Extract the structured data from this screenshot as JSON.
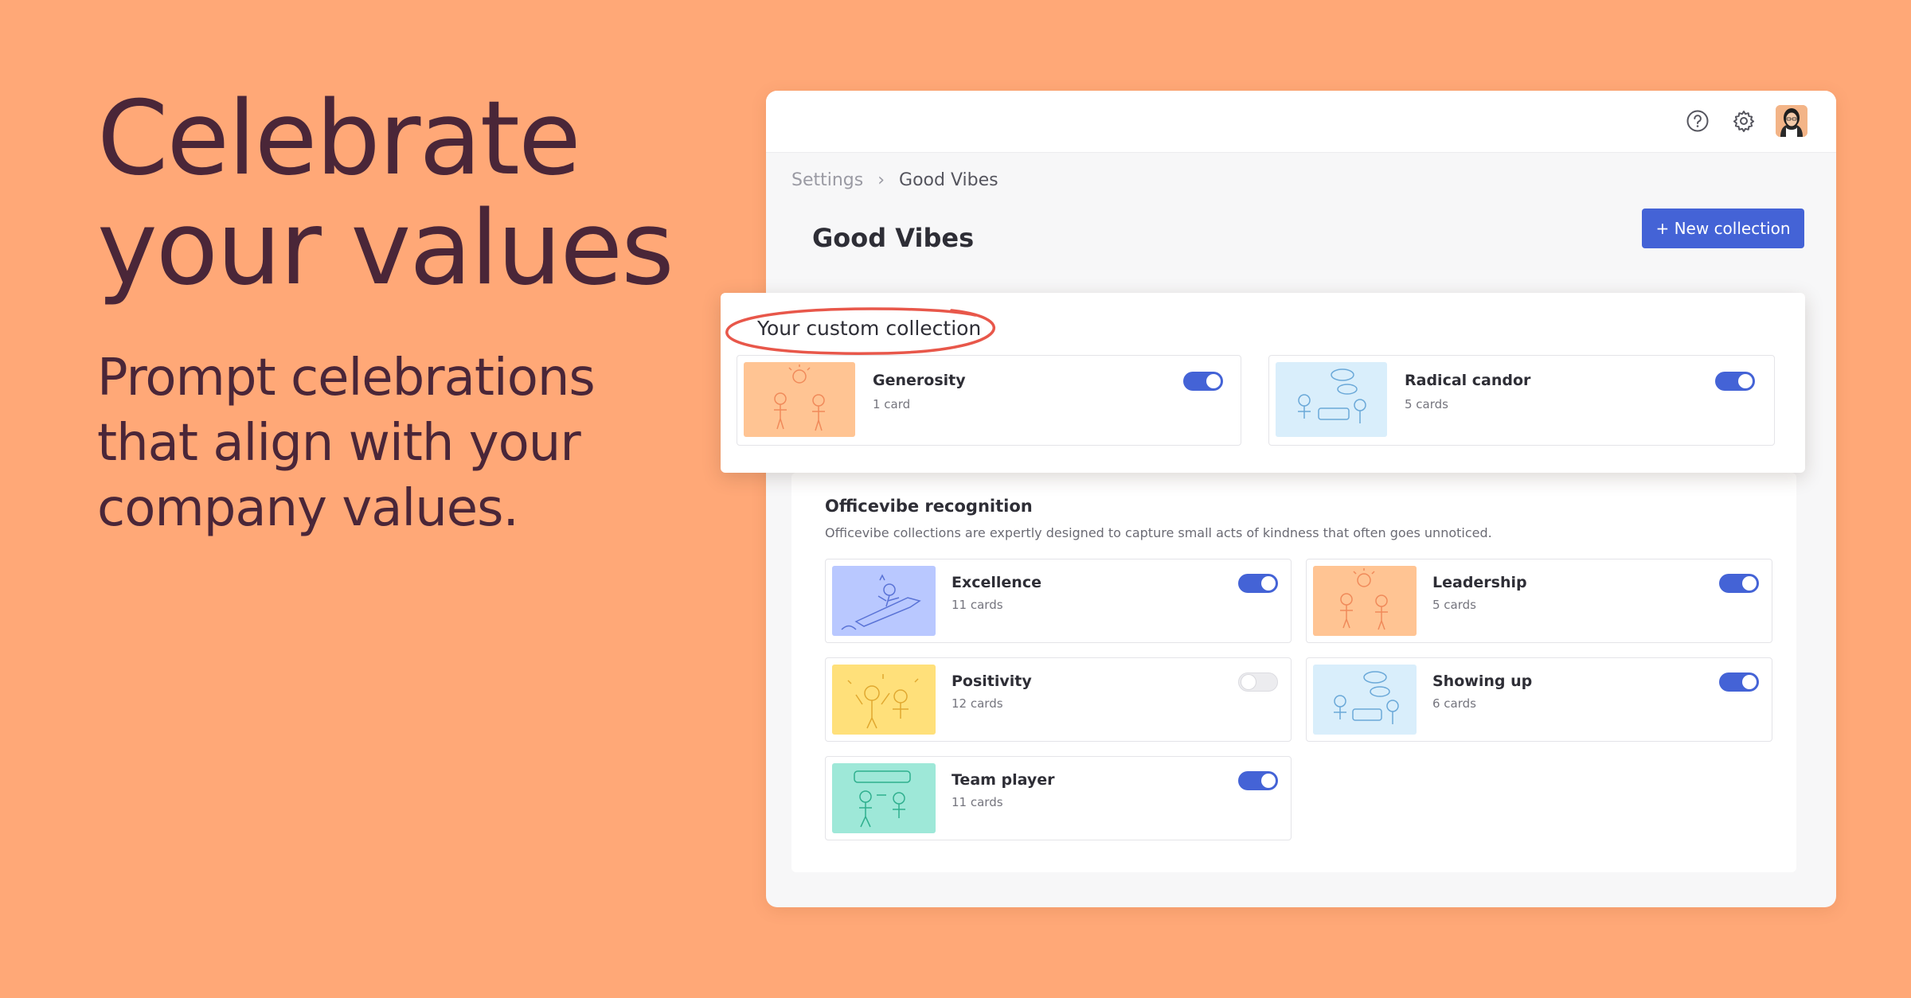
{
  "hero": {
    "title_line1": "Celebrate",
    "title_line2": "your values",
    "subtitle_line1": "Prompt celebrations",
    "subtitle_line2": "that align with your",
    "subtitle_line3": "company values."
  },
  "breadcrumb": {
    "parent": "Settings",
    "separator": "›",
    "current": "Good Vibes"
  },
  "page": {
    "title": "Good Vibes",
    "new_collection_label": "+ New collection"
  },
  "custom": {
    "title": "Your custom collection",
    "cards": [
      {
        "name": "Generosity",
        "count": "1 card",
        "enabled": true,
        "thumb_color": "#FFC493",
        "icon": "people-sun-illustration"
      },
      {
        "name": "Radical candor",
        "count": "5 cards",
        "enabled": true,
        "thumb_color": "#D9EEFB",
        "icon": "conversation-illustration"
      }
    ]
  },
  "officevibe": {
    "title": "Officevibe recognition",
    "description": "Officevibe collections are expertly designed to capture small acts of kindness that often goes unnoticed.",
    "cards": [
      {
        "name": "Excellence",
        "count": "11 cards",
        "enabled": true,
        "thumb_color": "#B9C8FF",
        "icon": "rocket-illustration"
      },
      {
        "name": "Leadership",
        "count": "5 cards",
        "enabled": true,
        "thumb_color": "#FFC493",
        "icon": "people-sun-illustration"
      },
      {
        "name": "Positivity",
        "count": "12 cards",
        "enabled": false,
        "thumb_color": "#FFE07A",
        "icon": "cheer-illustration"
      },
      {
        "name": "Showing up",
        "count": "6 cards",
        "enabled": true,
        "thumb_color": "#D9EEFB",
        "icon": "conversation-illustration"
      },
      {
        "name": "Team player",
        "count": "11 cards",
        "enabled": true,
        "thumb_color": "#9EE8D8",
        "icon": "team-illustration"
      }
    ]
  },
  "colors": {
    "background": "#FFA877",
    "primary": "#4463D6",
    "hero_text": "#4A2638",
    "highlight_circle": "#E8574A"
  }
}
